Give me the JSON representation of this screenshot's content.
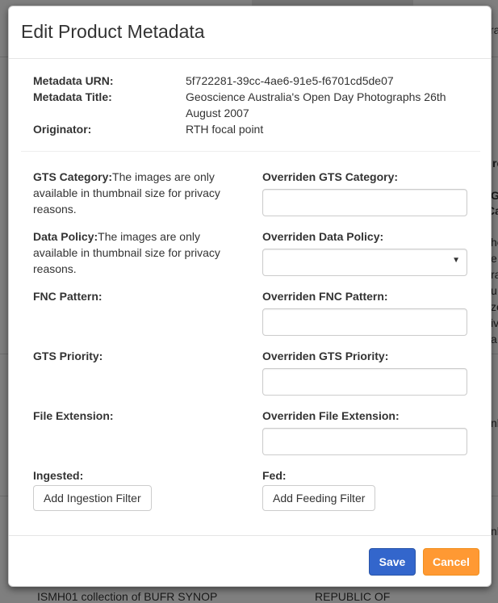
{
  "background": {
    "right_fragments": [
      "ra",
      "rc",
      "G",
      "Ca",
      "he",
      "e",
      "ra",
      "u",
      "ze",
      "iv",
      "a",
      "nk",
      "nk"
    ],
    "bottom_left": "ISMH01 collection of BUFR SYNOP",
    "bottom_right": "REPUBLIC OF"
  },
  "modal": {
    "title": "Edit Product Metadata",
    "meta": [
      {
        "label": "Metadata URN:",
        "value": "5f722281-39cc-4ae6-91e5-f6701cd5de07"
      },
      {
        "label": "Metadata Title:",
        "value": "Geoscience Australia's Open Day Photographs 26th August 2007"
      },
      {
        "label": "Originator:",
        "value": "RTH focal point"
      }
    ],
    "gts_category": {
      "label": "GTS Category:",
      "value": "The images are only available in thumbnail size for privacy reasons.",
      "override_label": "Overriden GTS Category:",
      "override_value": ""
    },
    "data_policy": {
      "label": "Data Policy:",
      "value": "The images are only available in thumbnail size for privacy reasons.",
      "override_label": "Overriden Data Policy:",
      "override_value": ""
    },
    "fnc_pattern": {
      "label": "FNC Pattern:",
      "override_label": "Overriden FNC Pattern:",
      "override_value": ""
    },
    "gts_priority": {
      "label": "GTS Priority:",
      "override_label": "Overriden GTS Priority:",
      "override_value": ""
    },
    "file_extension": {
      "label": "File Extension:",
      "override_label": "Overriden File Extension:",
      "override_value": ""
    },
    "ingested": {
      "label": "Ingested:",
      "button": "Add Ingestion Filter"
    },
    "fed": {
      "label": "Fed:",
      "button": "Add Feeding Filter"
    },
    "save_label": "Save",
    "cancel_label": "Cancel"
  },
  "icons": {
    "select_caret": "chevron-down-icon"
  },
  "colors": {
    "save": "#3366cc",
    "cancel": "#ff9933"
  }
}
